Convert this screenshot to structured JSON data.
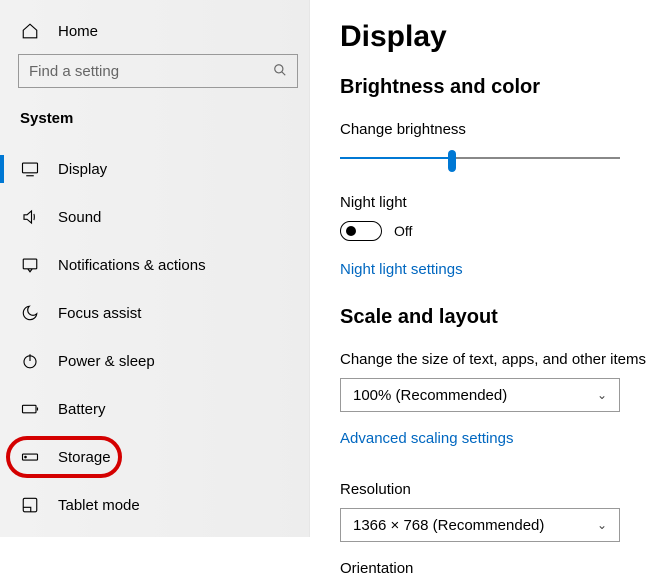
{
  "sidebar": {
    "home": "Home",
    "search_placeholder": "Find a setting",
    "section": "System",
    "items": [
      {
        "label": "Display",
        "selected": true,
        "icon": "monitor"
      },
      {
        "label": "Sound",
        "icon": "sound"
      },
      {
        "label": "Notifications & actions",
        "icon": "notifications"
      },
      {
        "label": "Focus assist",
        "icon": "moon"
      },
      {
        "label": "Power & sleep",
        "icon": "power"
      },
      {
        "label": "Battery",
        "icon": "battery"
      },
      {
        "label": "Storage",
        "icon": "storage",
        "annotated": true
      },
      {
        "label": "Tablet mode",
        "icon": "tablet"
      }
    ]
  },
  "main": {
    "title": "Display",
    "brightness_section": "Brightness and color",
    "brightness_label": "Change brightness",
    "brightness_percent": 40,
    "night_light_label": "Night light",
    "night_light_state": "Off",
    "night_light_link": "Night light settings",
    "scale_section": "Scale and layout",
    "scale_label": "Change the size of text, apps, and other items",
    "scale_value": "100% (Recommended)",
    "advanced_scaling_link": "Advanced scaling settings",
    "resolution_label": "Resolution",
    "resolution_value": "1366 × 768 (Recommended)",
    "orientation_label": "Orientation"
  }
}
